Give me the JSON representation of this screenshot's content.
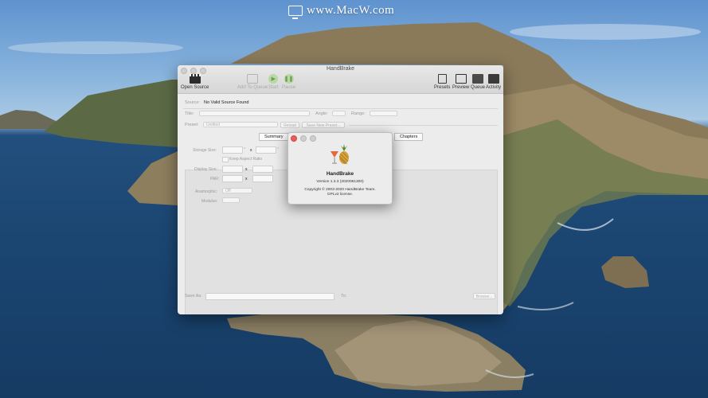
{
  "watermark": {
    "text": "www.MacW.com"
  },
  "window": {
    "title": "HandBrake",
    "toolbar": {
      "open_source": "Open Source",
      "add_to_queue": "Add To Queue",
      "start": "Start",
      "pause": "Pause",
      "presets": "Presets",
      "preview": "Preview",
      "queue": "Queue",
      "activity": "Activity"
    },
    "source": {
      "label": "Source:",
      "value": "No Valid Source Found"
    },
    "title_row": {
      "title_label": "Title:",
      "angle_label": "Angle:",
      "range_label": "Range:"
    },
    "preset_row": {
      "label": "Preset:",
      "value": "Untitled",
      "reload": "Reload",
      "save_new": "Save New Preset..."
    },
    "tabs": [
      {
        "label": "Summary",
        "selected": true
      },
      {
        "label": "Chapters",
        "selected": false
      }
    ],
    "dimensions": {
      "storage_size": "Storage Size:",
      "keep_aspect": "Keep Aspect Ratio",
      "display_size": "Display Size:",
      "par": "PAR:",
      "anamorphic": "Anamorphic:",
      "anamorphic_value": "Off",
      "modulus": "Modulus:",
      "times": "x"
    },
    "footer": {
      "save_as": "Save As:",
      "to": "To:",
      "browse": "Browse..."
    }
  },
  "about": {
    "name": "HandBrake",
    "version": "Version 1.3.3 (2020061300)",
    "copyright": "Copyright © 2003-2020 HandBrake Team.",
    "license": "GPLv2 license."
  },
  "colors": {
    "close_red": "#ee5b57",
    "sea": "#1b4672",
    "sky": "#86b2dc"
  },
  "icons": {
    "open_source": "clapperboard-icon",
    "add_to_queue": "queue-add-icon",
    "start": "play-icon",
    "pause": "pause-icon",
    "presets": "presets-icon",
    "preview": "preview-icon",
    "queue": "queue-icon",
    "activity": "activity-icon",
    "logo": "handbrake-logo"
  }
}
